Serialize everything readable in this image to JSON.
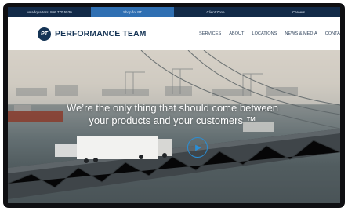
{
  "topbar": {
    "items": [
      {
        "label": "Headquarters: 866.770.5530",
        "active": false
      },
      {
        "label": "Shop for PT",
        "active": true
      },
      {
        "label": "Client Zone",
        "active": false
      },
      {
        "label": "Careers",
        "active": false
      }
    ]
  },
  "header": {
    "logo_badge": "PT",
    "logo_text": "PERFORMANCE TEAM",
    "nav": [
      "SERVICES",
      "ABOUT",
      "LOCATIONS",
      "NEWS & MEDIA",
      "CONTA"
    ]
  },
  "hero": {
    "caption_line1": "We’re the only thing that should come between",
    "caption_line2": "your products and your customers ™",
    "play_icon": "play-circle-icon"
  },
  "colors": {
    "topbar_bg": "#122a48",
    "topbar_active": "#2f6fb2",
    "brand_navy": "#153455",
    "play_accent": "#2a8fd6"
  }
}
